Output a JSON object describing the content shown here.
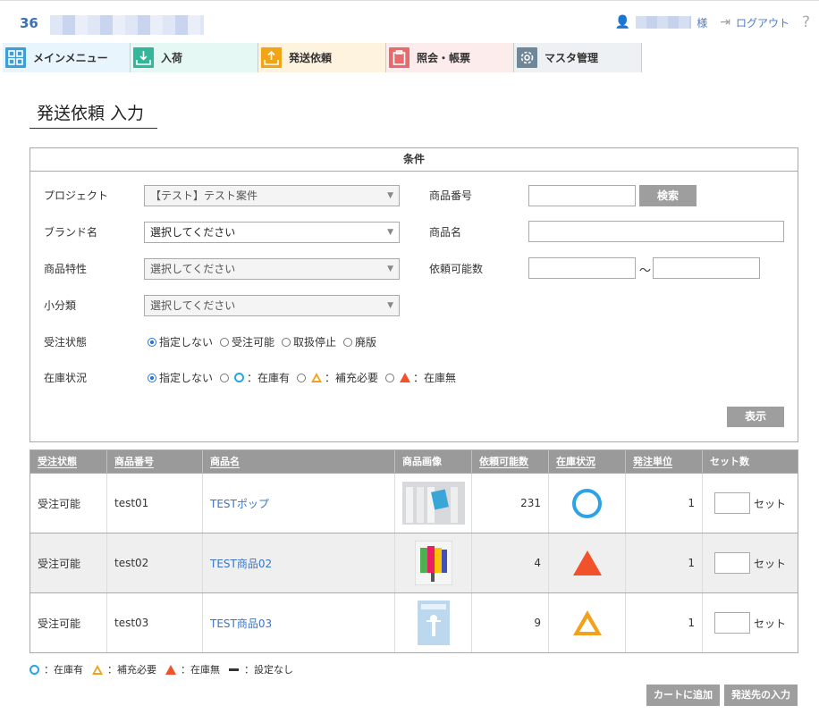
{
  "header": {
    "logo_number": "36",
    "user_suffix": "様",
    "logout_label": "ログアウト",
    "help_label": "?"
  },
  "nav": {
    "main": "メインメニュー",
    "inbound": "入荷",
    "shipping": "発送依頼",
    "inquiry": "照会・帳票",
    "master": "マスタ管理"
  },
  "page": {
    "title": "発送依頼 入力"
  },
  "conditions": {
    "title": "条件",
    "project_label": "プロジェクト",
    "project_value": "【テスト】テスト案件",
    "brand_label": "ブランド名",
    "brand_value": "選択してください",
    "product_feature_label": "商品特性",
    "product_feature_value": "選択してください",
    "subcategory_label": "小分類",
    "subcategory_value": "選択してください",
    "order_status_label": "受注状態",
    "order_status_options": [
      "指定しない",
      "受注可能",
      "取扱停止",
      "廃版"
    ],
    "stock_status_label": "在庫状況",
    "stock_none": "指定しない",
    "stock_in": "：在庫有",
    "stock_refill": "：補充必要",
    "stock_out": "：在庫無",
    "product_code_label": "商品番号",
    "search_button": "検索",
    "product_name_label": "商品名",
    "request_qty_label": "依頼可能数",
    "range_sep": "～",
    "show_button": "表示"
  },
  "table": {
    "headers": [
      "受注状態",
      "商品番号",
      "商品名",
      "商品画像",
      "依頼可能数",
      "在庫状況",
      "発注単位",
      "セット数"
    ],
    "rows": [
      {
        "status": "受注可能",
        "code": "test01",
        "name": "TESTポップ",
        "qty": "231",
        "stock": "circle",
        "unit": "1",
        "set_label": "セット"
      },
      {
        "status": "受注可能",
        "code": "test02",
        "name": "TEST商品02",
        "qty": "4",
        "stock": "triangle-filled",
        "unit": "1",
        "set_label": "セット"
      },
      {
        "status": "受注可能",
        "code": "test03",
        "name": "TEST商品03",
        "qty": "9",
        "stock": "triangle-outline",
        "unit": "1",
        "set_label": "セット"
      }
    ]
  },
  "legend": {
    "in_stock": "：在庫有",
    "refill": "：補充必要",
    "out": "：在庫無",
    "unset": "：設定なし"
  },
  "footer": {
    "add_cart": "カートに追加",
    "enter_destination": "発送先の入力"
  },
  "colors": {
    "accent_blue": "#3a76c4",
    "circle_blue": "#2ba3e6",
    "tri_red": "#f1522b",
    "tri_orange": "#f1a11b"
  }
}
